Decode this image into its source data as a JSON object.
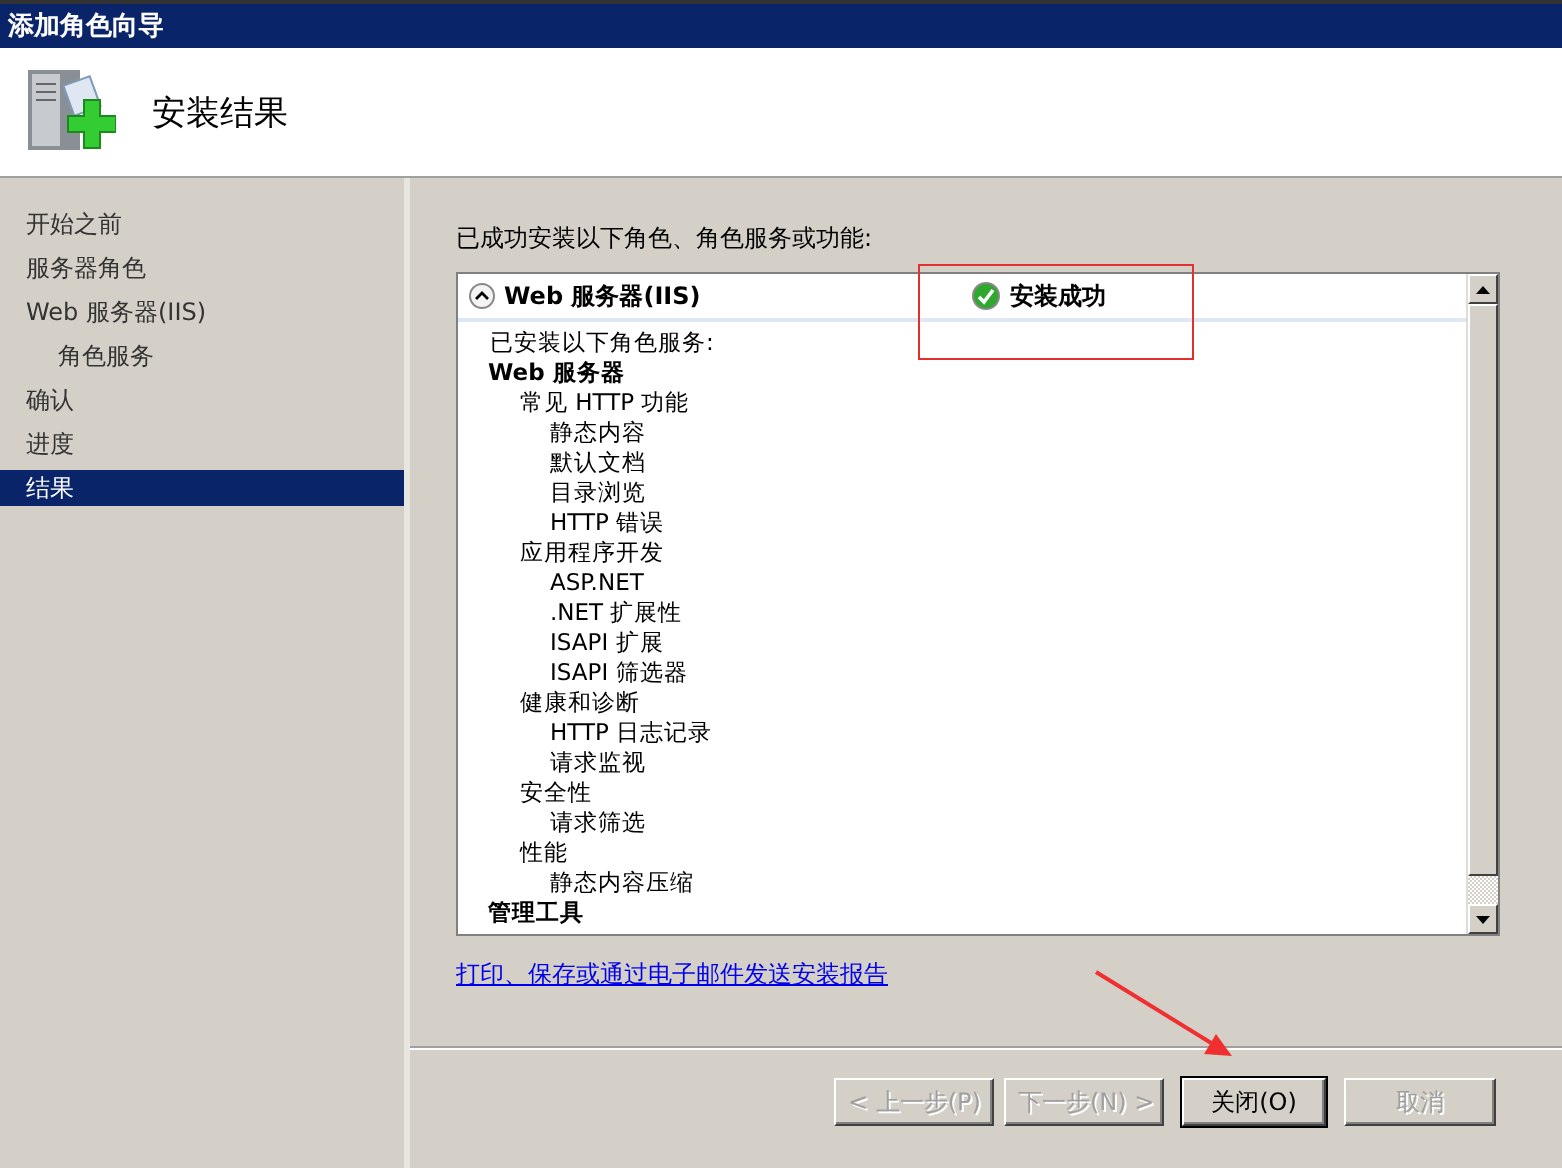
{
  "window": {
    "title": "添加角色向导"
  },
  "header": {
    "title": "安装结果"
  },
  "sidebar": {
    "items": [
      {
        "label": "开始之前",
        "selected": false
      },
      {
        "label": "服务器角色",
        "selected": false
      },
      {
        "label": "Web 服务器(IIS)",
        "selected": false,
        "children": [
          {
            "label": "角色服务",
            "selected": false
          }
        ]
      },
      {
        "label": "确认",
        "selected": false
      },
      {
        "label": "进度",
        "selected": false
      },
      {
        "label": "结果",
        "selected": true
      }
    ]
  },
  "main": {
    "intro": "已成功安装以下角色、角色服务或功能:",
    "result": {
      "role": "Web 服务器(IIS)",
      "expanded": true,
      "status": "安装成功",
      "details_intro": "已安装以下角色服务:",
      "tree": [
        {
          "label": "Web 服务器",
          "children": [
            {
              "label": "常见 HTTP 功能",
              "children": [
                {
                  "label": "静态内容"
                },
                {
                  "label": "默认文档"
                },
                {
                  "label": "目录浏览"
                },
                {
                  "label": "HTTP 错误"
                }
              ]
            },
            {
              "label": "应用程序开发",
              "children": [
                {
                  "label": "ASP.NET"
                },
                {
                  "label": ".NET 扩展性"
                },
                {
                  "label": "ISAPI 扩展"
                },
                {
                  "label": "ISAPI 筛选器"
                }
              ]
            },
            {
              "label": "健康和诊断",
              "children": [
                {
                  "label": "HTTP 日志记录"
                },
                {
                  "label": "请求监视"
                }
              ]
            },
            {
              "label": "安全性",
              "children": [
                {
                  "label": "请求筛选"
                }
              ]
            },
            {
              "label": "性能",
              "children": [
                {
                  "label": "静态内容压缩"
                }
              ]
            }
          ]
        },
        {
          "label": "管理工具"
        }
      ]
    },
    "report_link": "打印、保存或通过电子邮件发送安装报告"
  },
  "buttons": [
    {
      "label": "< 上一步(P)",
      "disabled": true,
      "default": false
    },
    {
      "label": "下一步(N) >",
      "disabled": true,
      "default": false
    },
    {
      "label": "关闭(O)",
      "disabled": false,
      "default": true
    },
    {
      "label": "取消",
      "disabled": true,
      "default": false
    }
  ]
}
